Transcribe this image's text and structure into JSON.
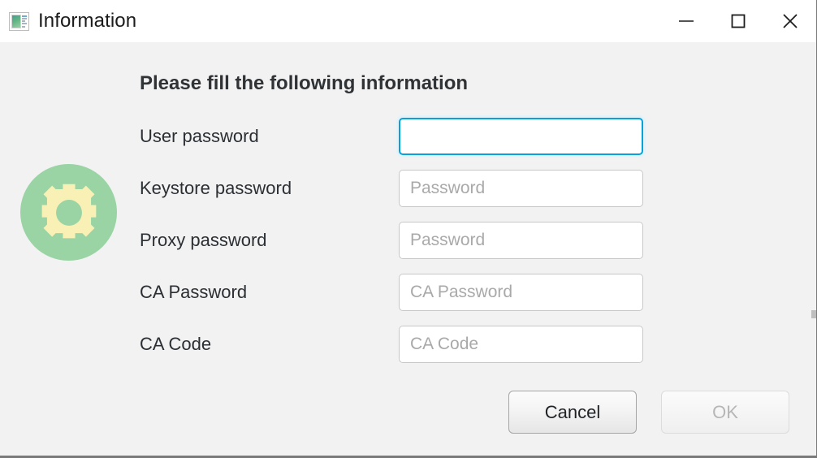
{
  "window": {
    "title": "Information",
    "icon": "window-list-icon",
    "controls": [
      {
        "name": "minimize",
        "glyph": "minimize-icon"
      },
      {
        "name": "maximize",
        "glyph": "maximize-icon"
      },
      {
        "name": "close",
        "glyph": "close-icon"
      }
    ]
  },
  "colors": {
    "accent_focus_border": "#07a2d8",
    "focus_glow": "#e2f3fa",
    "badge_circle": "#9ad4a4",
    "badge_gear": "#f8f0b5",
    "window_background": "#f2f2f2",
    "titlebar_background": "#ffffff",
    "heading_text": "#303336",
    "label_text": "#2b2f33",
    "placeholder_text": "#a9a9a9",
    "disabled_text": "#b6b6b6"
  },
  "main": {
    "badge_icon": "gear-icon",
    "heading": "Please fill the following information",
    "fields": [
      {
        "label": "User password",
        "value": "",
        "placeholder": "",
        "focused": true,
        "name": "user-password"
      },
      {
        "label": "Keystore password",
        "value": "",
        "placeholder": "Password",
        "focused": false,
        "name": "keystore-password"
      },
      {
        "label": "Proxy password",
        "value": "",
        "placeholder": "Password",
        "focused": false,
        "name": "proxy-password"
      },
      {
        "label": "CA Password",
        "value": "",
        "placeholder": "CA Password",
        "focused": false,
        "name": "ca-password"
      },
      {
        "label": "CA Code",
        "value": "",
        "placeholder": "CA Code",
        "focused": false,
        "name": "ca-code"
      }
    ]
  },
  "footer": {
    "cancel_label": "Cancel",
    "ok_label": "OK",
    "ok_disabled": true
  }
}
